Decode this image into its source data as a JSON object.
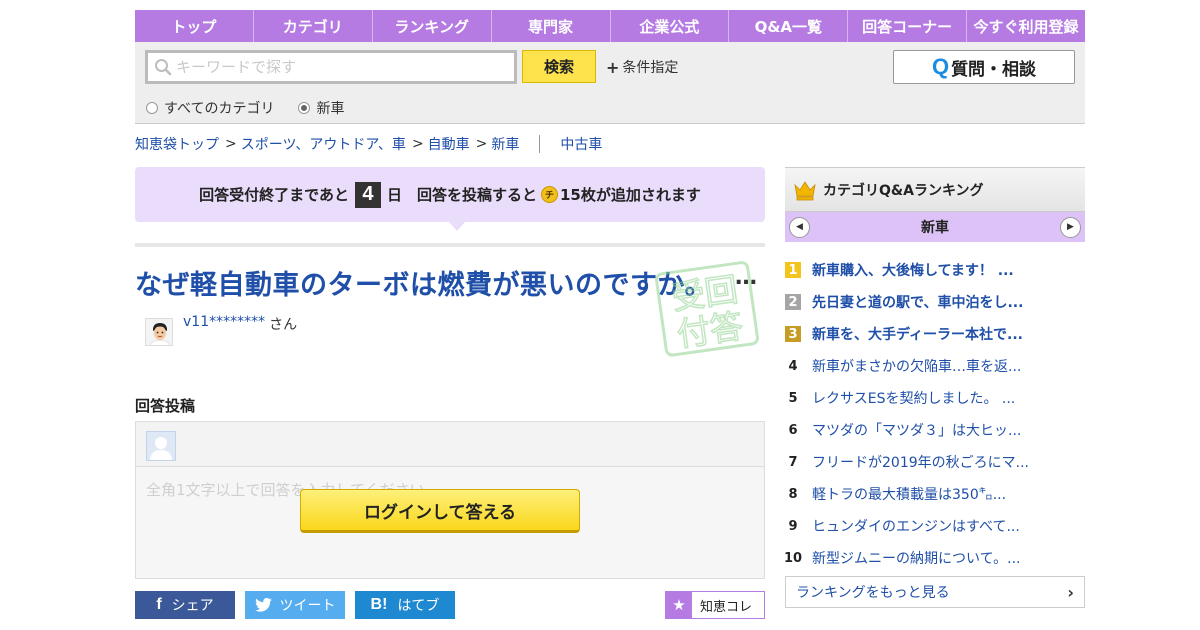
{
  "nav": [
    "トップ",
    "カテゴリ",
    "ランキング",
    "専門家",
    "企業公式",
    "Q&A一覧",
    "回答コーナー",
    "今すぐ利用登録"
  ],
  "search": {
    "placeholder": "キーワードで探す",
    "button": "検索",
    "condition": "条件指定",
    "ask_button": "質問・相談",
    "ask_icon_letter": "Q",
    "radio_all": "すべてのカテゴリ",
    "radio_current": "新車"
  },
  "breadcrumb": {
    "items": [
      "知恵袋トップ",
      "スポーツ、アウトドア、車",
      "自動車",
      "新車"
    ],
    "sep": ">",
    "extra": "中古車"
  },
  "notice": {
    "part1": "回答受付終了まであと",
    "days": "4",
    "part2": "日　回答を投稿すると",
    "coin": "チ",
    "part3": "15枚が追加されます"
  },
  "question": {
    "title": "なぜ軽自動車のターボは燃費が悪いのですか。",
    "ellipsis": "…",
    "stamp_top": "受回",
    "stamp_bottom": "付答",
    "user": "v11********",
    "honorific": "さん"
  },
  "answer": {
    "heading": "回答投稿",
    "placeholder": "全角1文字以上で回答を入力してください",
    "login_button": "ログインして答える"
  },
  "share": {
    "fb_icon": "f",
    "fb": "シェア",
    "tw": "ツイート",
    "hb_icon": "B!",
    "hb": "はてブ",
    "chie_icon": "★",
    "chie": "知恵コレ"
  },
  "ranking": {
    "title": "カテゴリQ&Aランキング",
    "category": "新車",
    "prev_icon": "◀",
    "next_icon": "▶",
    "items": [
      {
        "num": "1",
        "text": "新車購入、大後悔してます！ ..."
      },
      {
        "num": "2",
        "text": "先日妻と道の駅で、車中泊をし..."
      },
      {
        "num": "3",
        "text": "新車を、大手ディーラー本社で..."
      },
      {
        "num": "4",
        "text": "新車がまさかの欠陥車…車を返..."
      },
      {
        "num": "5",
        "text": "レクサスESを契約しました。 ..."
      },
      {
        "num": "6",
        "text": "マツダの「マツダ３」は大ヒッ..."
      },
      {
        "num": "7",
        "text": "フリードが2019年の秋ごろにマ..."
      },
      {
        "num": "8",
        "text": "軽トラの最大積載量は350㌔..."
      },
      {
        "num": "9",
        "text": "ヒュンダイのエンジンはすべて..."
      },
      {
        "num": "10",
        "text": "新型ジムニーの納期について。..."
      }
    ],
    "more": "ランキングをもっと見る",
    "more_icon": "›"
  },
  "colors": {
    "nav": "#b57be3",
    "link": "#1f4fa8",
    "button_yellow": "#ffe34d",
    "notice_bg": "#eadcfb",
    "facebook": "#3b5998",
    "twitter": "#55acee",
    "hatena": "#1e88d0"
  }
}
